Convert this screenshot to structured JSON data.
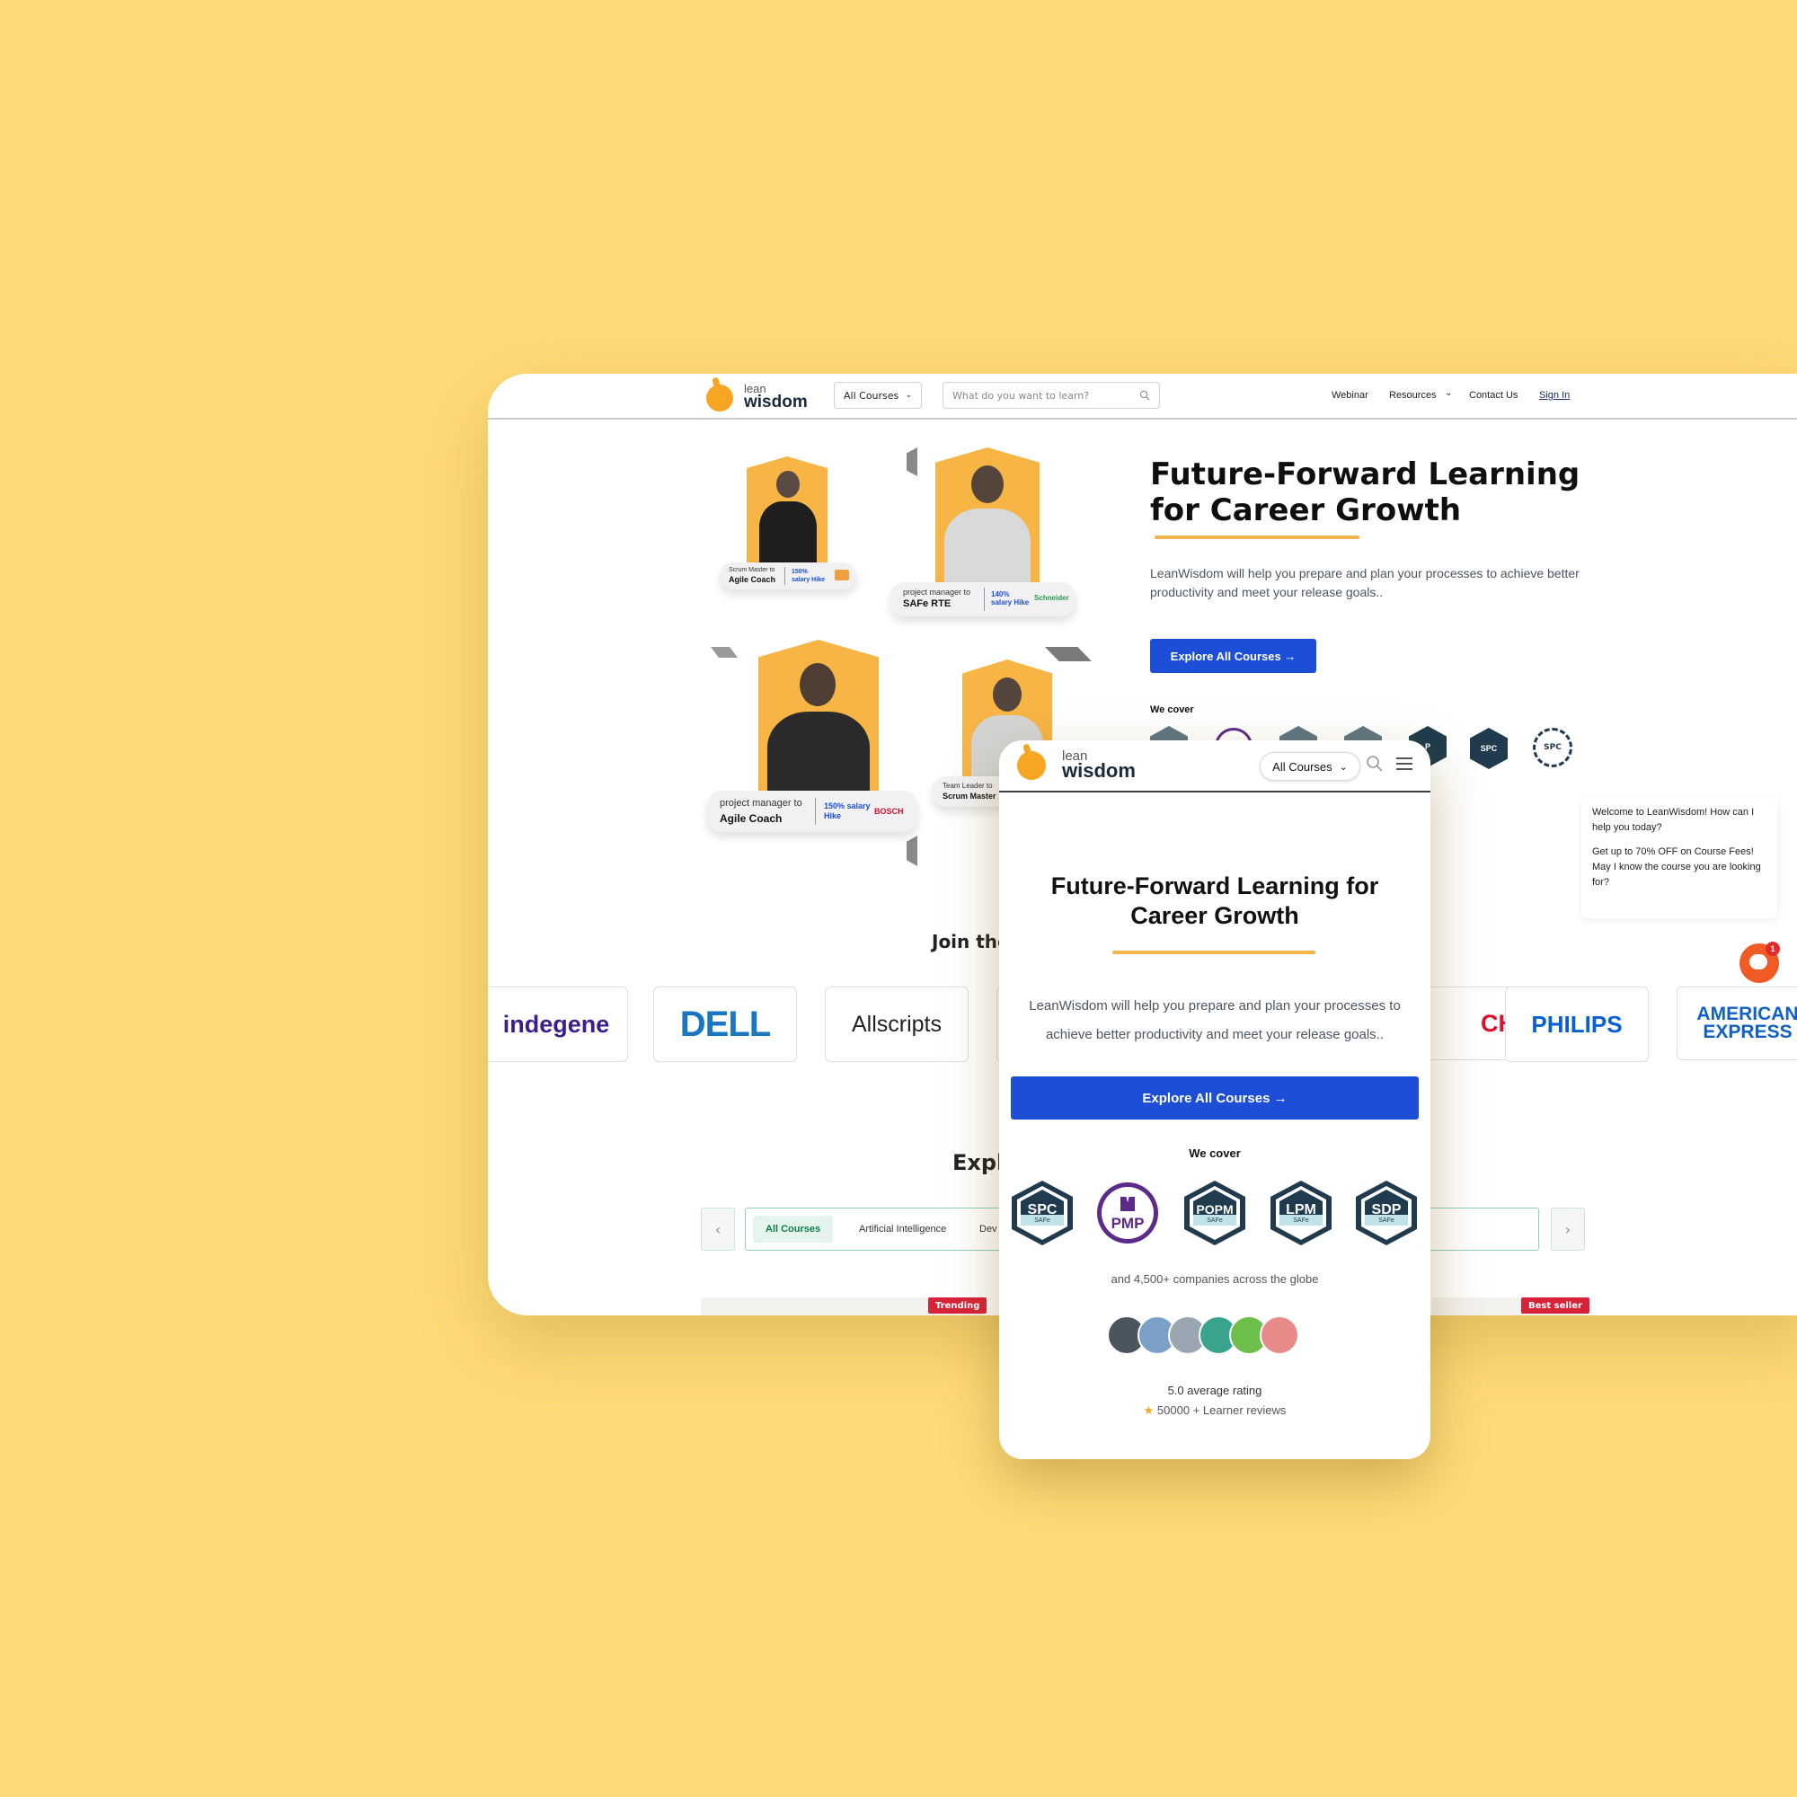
{
  "brand": {
    "logo_line1": "lean",
    "logo_line2": "wisdom"
  },
  "desktop": {
    "nav": {
      "category_select": "All Courses",
      "search_placeholder": "What do you want to learn?",
      "links": {
        "webinar": "Webinar",
        "resources": "Resources",
        "contact": "Contact Us",
        "signin": "Sign In"
      }
    },
    "hero": {
      "title": "Future-Forward Learning for Career Growth",
      "description": "LeanWisdom will help you prepare and plan your processes to achieve better productivity and meet your release goals..",
      "cta": "Explore All Courses →",
      "we_cover": "We cover",
      "badges": [
        "",
        "",
        "",
        "",
        "P",
        "SPC",
        "SPC"
      ]
    },
    "testimonials": [
      {
        "from": "Scrum Master to",
        "to": "Agile Coach",
        "hike": "150% salary Hike",
        "company": ""
      },
      {
        "from": "project manager to",
        "to": "SAFe RTE",
        "hike": "140% salary Hike",
        "company": "Schneider"
      },
      {
        "from": "project manager to",
        "to": "Agile Coach",
        "hike": "150% salary Hike",
        "company": "BOSCH"
      },
      {
        "from": "Team Leader  to",
        "to": "Scrum Master",
        "hike": "",
        "company": ""
      }
    ],
    "join_title": "Join the",
    "company_logos": [
      "indegene",
      "DELL",
      "Allscripts",
      "CH",
      "PHILIPS",
      "AMERICAN EXPRESS"
    ],
    "explore_title": "Expl",
    "tabs": [
      "All Courses",
      "Artificial Intelligence",
      "Dev"
    ],
    "course_tags": [
      "Trending",
      "Best seller"
    ]
  },
  "chat": {
    "line1": "Welcome to LeanWisdom! How can I help you today?",
    "line2": "Get up to 70% OFF on Course Fees!",
    "line3": "May I know the course you are looking for?",
    "unread": "1"
  },
  "mobile": {
    "category_select": "All Courses",
    "title": "Future-Forward Learning for Career Growth",
    "description": "LeanWisdom will help you prepare and plan your processes to achieve better productivity and meet your release goals..",
    "cta": "Explore All Courses →",
    "we_cover": "We cover",
    "badges": [
      {
        "name": "SPC",
        "sub": "SAFe"
      },
      {
        "name": "PMP",
        "sub": ""
      },
      {
        "name": "POPM",
        "sub": "SAFe"
      },
      {
        "name": "LPM",
        "sub": "SAFe"
      },
      {
        "name": "SDP",
        "sub": "SAFe"
      }
    ],
    "companies_text": "and 4,500+ companies across the globe",
    "rating_text": "5.0 average rating",
    "reviews_text": "50000 + Learner reviews"
  },
  "colors": {
    "background": "#FFDB78",
    "brand_blue": "#1D4ED8",
    "brand_orange": "#F6A623",
    "accent_green": "#0d7a47"
  }
}
